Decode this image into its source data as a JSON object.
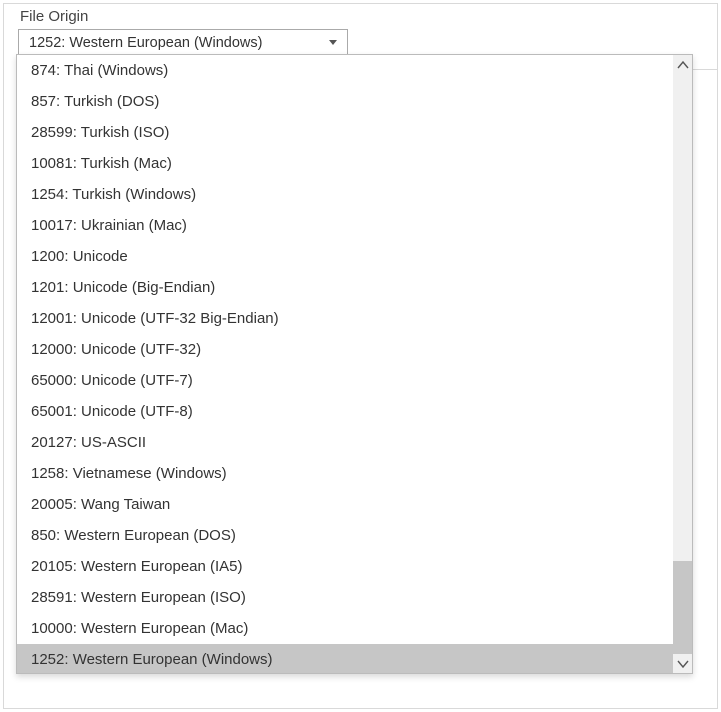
{
  "label": "File Origin",
  "selected": "1252: Western European (Windows)",
  "options": [
    {
      "label": "874: Thai (Windows)",
      "selected": false
    },
    {
      "label": "857: Turkish (DOS)",
      "selected": false
    },
    {
      "label": "28599: Turkish (ISO)",
      "selected": false
    },
    {
      "label": "10081: Turkish (Mac)",
      "selected": false
    },
    {
      "label": "1254: Turkish (Windows)",
      "selected": false
    },
    {
      "label": "10017: Ukrainian (Mac)",
      "selected": false
    },
    {
      "label": "1200: Unicode",
      "selected": false
    },
    {
      "label": "1201: Unicode (Big-Endian)",
      "selected": false
    },
    {
      "label": "12001: Unicode (UTF-32 Big-Endian)",
      "selected": false
    },
    {
      "label": "12000: Unicode (UTF-32)",
      "selected": false
    },
    {
      "label": "65000: Unicode (UTF-7)",
      "selected": false
    },
    {
      "label": "65001: Unicode (UTF-8)",
      "selected": false
    },
    {
      "label": "20127: US-ASCII",
      "selected": false
    },
    {
      "label": "1258: Vietnamese (Windows)",
      "selected": false
    },
    {
      "label": "20005: Wang Taiwan",
      "selected": false
    },
    {
      "label": "850: Western European (DOS)",
      "selected": false
    },
    {
      "label": "20105: Western European (IA5)",
      "selected": false
    },
    {
      "label": "28591: Western European (ISO)",
      "selected": false
    },
    {
      "label": "10000: Western European (Mac)",
      "selected": false
    },
    {
      "label": "1252: Western European (Windows)",
      "selected": true
    }
  ],
  "scroll": {
    "thumb_top_pct": 84,
    "thumb_height_pct": 16
  }
}
